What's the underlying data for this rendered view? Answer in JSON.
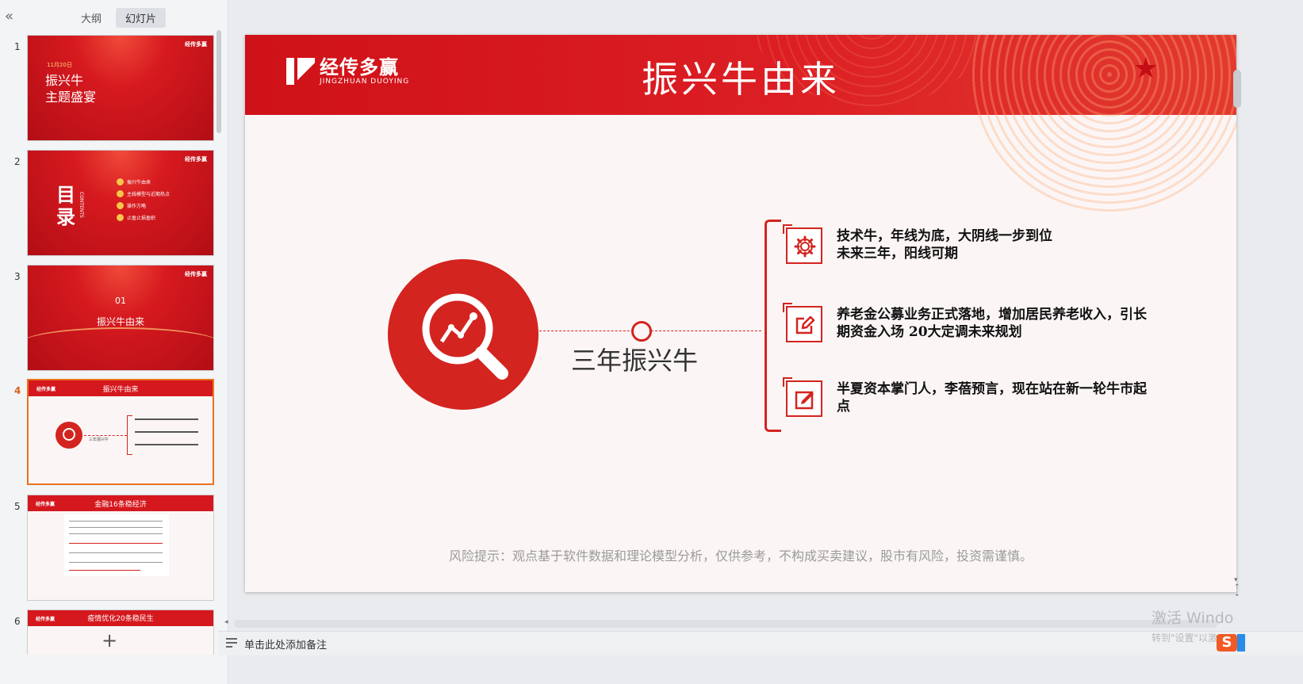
{
  "left_panel": {
    "collapse_icon": "«",
    "tabs": [
      {
        "label": "大纲",
        "active": false
      },
      {
        "label": "幻灯片",
        "active": true
      }
    ],
    "add_icon": "+"
  },
  "thumbnails": [
    {
      "num": "1",
      "date": "11月20日",
      "title_line1": "振兴牛",
      "title_line2": "主题盛宴",
      "logo": "经传多赢"
    },
    {
      "num": "2",
      "big": "目录",
      "sub": "CONTENTS",
      "items": [
        "振兴牛由来",
        "主线模型与近期热点",
        "操作方略",
        "止盈止损盈织"
      ],
      "logo": "经传多赢"
    },
    {
      "num": "3",
      "index": "01",
      "title": "振兴牛由来",
      "logo": "经传多赢"
    },
    {
      "num": "4",
      "title": "振兴牛由来",
      "center": "三年振兴牛",
      "logo": "经传多赢"
    },
    {
      "num": "5",
      "title": "金融16条稳经济",
      "logo": "经传多赢"
    },
    {
      "num": "6",
      "title": "疫情优化20条稳民生",
      "logo": "经传多赢"
    }
  ],
  "slide": {
    "logo_cn": "经传多赢",
    "logo_en": "JINGZHUAN DUOYING",
    "title": "振兴牛由来",
    "center_label": "三年振兴牛",
    "items": [
      {
        "icon": "gear-icon",
        "line1": "技术牛，年线为底，大阴线一步到位",
        "line2": "未来三年，阳线可期"
      },
      {
        "icon": "edit-icon",
        "line1": "养老金公募业务正式落地，增加居民养老收入，引长",
        "line2": "期资金入场  20大定调未来规划"
      },
      {
        "icon": "pencil-box-icon",
        "line1": "半夏资本掌门人，李蓓预言，现在站在新一轮牛市起",
        "line2": "点"
      }
    ],
    "risk_note": "风险提示：观点基于软件数据和理论模型分析，仅供参考，不构成买卖建议，股市有风险，投资需谨慎。"
  },
  "notes": {
    "placeholder": "单击此处添加备注"
  },
  "watermark": {
    "line1": "激活 Windo",
    "line2": "转到\"设置\"以激"
  },
  "colors": {
    "accent_red": "#d3241f",
    "active_thumb_border": "#e8731e"
  }
}
